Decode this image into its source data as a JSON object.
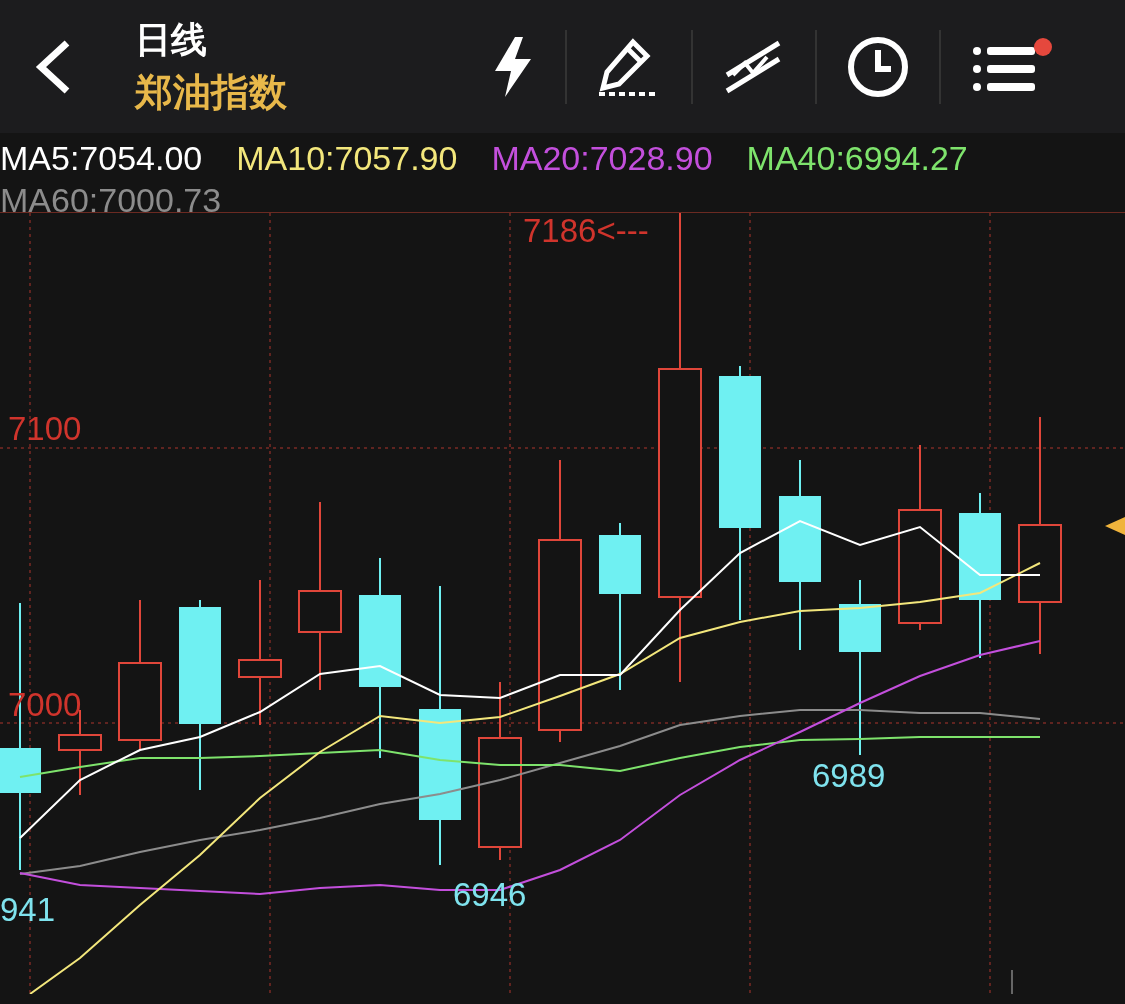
{
  "header": {
    "title": "日线",
    "subtitle": "郑油指数",
    "menu_notification": true
  },
  "legend": [
    {
      "text": "MA5:7054.00",
      "color": "#ffffff"
    },
    {
      "text": "MA10:7057.90",
      "color": "#f3e77c"
    },
    {
      "text": "MA20:7028.90",
      "color": "#c34fdc"
    },
    {
      "text": "MA40:6994.27",
      "color": "#7ee36c"
    },
    {
      "text": "MA60:7000.73",
      "color": "#8c8c8c"
    }
  ],
  "chart": {
    "price_labels": [
      {
        "text": "7100",
        "kind": "axis"
      },
      {
        "text": "7000",
        "kind": "axis"
      },
      {
        "text": "7186<---",
        "kind": "high"
      },
      {
        "text": "6989",
        "kind": "low"
      },
      {
        "text": "6946",
        "kind": "low"
      },
      {
        "text": "941",
        "kind": "low"
      }
    ]
  }
}
